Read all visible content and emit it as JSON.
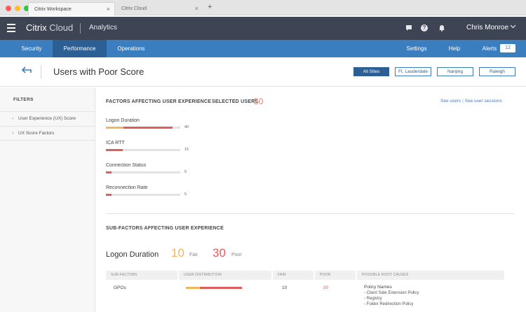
{
  "browser": {
    "tabs": [
      {
        "label": "Citrix Workspace",
        "close": "×"
      },
      {
        "label": "Citrix Cloud",
        "close": "×"
      }
    ],
    "new_tab": "+",
    "dot_colors": [
      "#ff5f57",
      "#febc2e",
      "#28c840"
    ]
  },
  "header": {
    "brand_primary": "Citrix",
    "brand_secondary": "Cloud",
    "section": "Analytics",
    "user": "Chris Monroe",
    "icons": [
      "chat-icon",
      "help-icon",
      "bell-icon"
    ]
  },
  "nav": {
    "items": [
      "Security",
      "Performance",
      "Operations"
    ],
    "active": "Performance",
    "right": [
      "Settings",
      "Help",
      "Alerts"
    ],
    "alerts_count": "12"
  },
  "page": {
    "title": "Users with Poor Score",
    "sites": [
      "All Sites",
      "Ft. Lauderdale",
      "Nanjing",
      "Raleigh"
    ],
    "active_site": "All Sites"
  },
  "sidebar": {
    "title": "FILTERS",
    "items": [
      "User Experience (UX) Score",
      "UX Score Factors"
    ]
  },
  "factors": {
    "heading": "FACTORS AFFECTING USER EXPERIENCE",
    "selected_label": "SELECTED USERS",
    "selected_count": "50",
    "see_users": "See users",
    "link_sep": "|",
    "see_sessions": "See user sessions",
    "items": [
      {
        "name": "Logon Duration",
        "count": "40",
        "fair_pct": 24,
        "poor_pct": 66
      },
      {
        "name": "ICA RTT",
        "count": "15",
        "fair_pct": 0,
        "poor_pct": 23
      },
      {
        "name": "Connection Status",
        "count": "5",
        "fair_pct": 0,
        "poor_pct": 8
      },
      {
        "name": "Reconnection Rate",
        "count": "5",
        "fair_pct": 0,
        "poor_pct": 8
      }
    ]
  },
  "subfactors": {
    "heading": "SUB-FACTORS AFFECTING USER EXPERIENCE",
    "selected": "Logon Duration",
    "fair_count": "10",
    "fair_label": "Fair",
    "poor_count": "30",
    "poor_label": "Poor",
    "columns": [
      "SUB-FACTORS",
      "USER DISTRIBUTION",
      "FAIR",
      "POOR",
      "POSSIBLE ROOT CAUSES"
    ],
    "rows": [
      {
        "name": "GPOs",
        "fair": "10",
        "poor": "30",
        "fair_pct": 25,
        "poor_pct": 75,
        "causes": [
          "Policy Names",
          "- Client Side Extension Policy",
          "- Registry",
          "- Folder Redirection Policy"
        ]
      }
    ]
  },
  "colors": {
    "header_bg": "#3d4453",
    "nav_bg": "#3b7ec0",
    "nav_active": "#2c5f94",
    "fair": "#f2b65c",
    "poor": "#e05d5d",
    "accent_orange": "#f07c5f"
  }
}
